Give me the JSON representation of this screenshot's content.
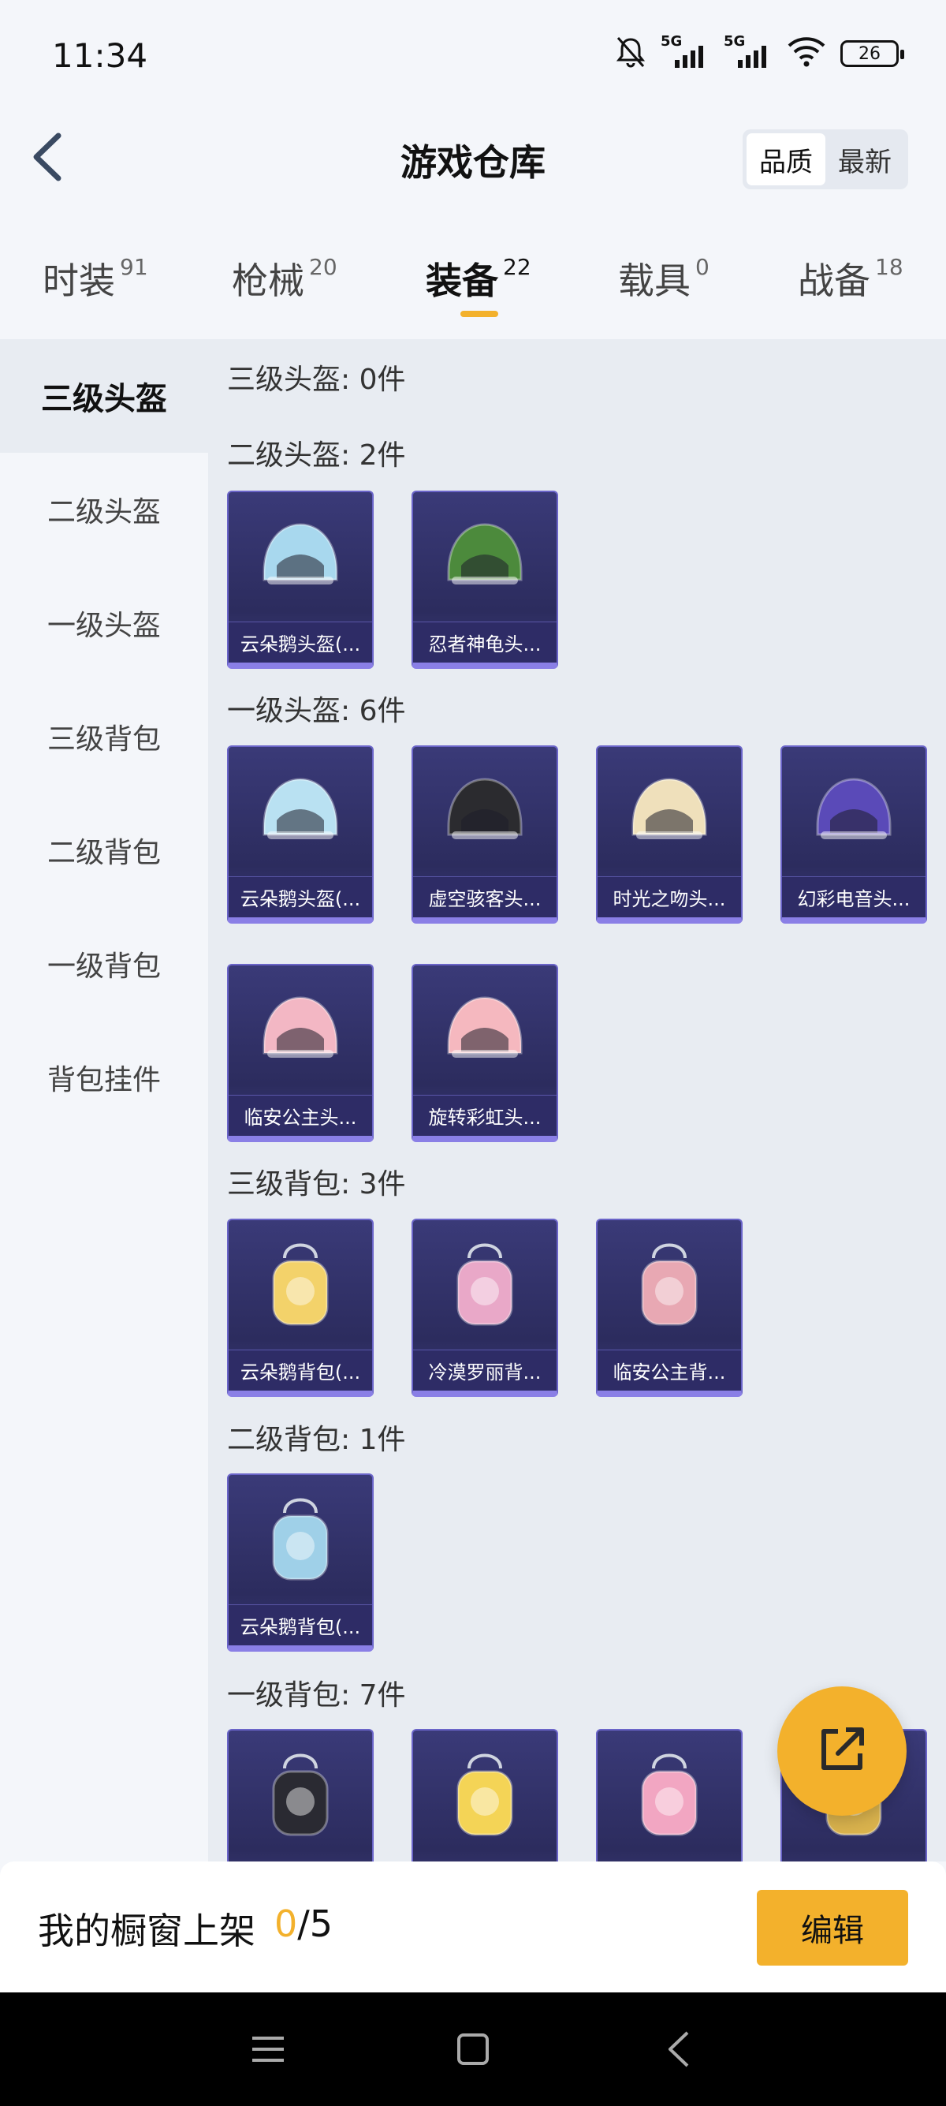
{
  "status_bar": {
    "time": "11:34",
    "signal_1": "5G",
    "signal_2": "5G",
    "battery": "26"
  },
  "header": {
    "title": "游戏仓库",
    "sort_options": [
      "品质",
      "最新"
    ],
    "sort_active": "品质"
  },
  "tabs": [
    {
      "label": "时装",
      "count": "91"
    },
    {
      "label": "枪械",
      "count": "20"
    },
    {
      "label": "装备",
      "count": "22",
      "active": true
    },
    {
      "label": "载具",
      "count": "0"
    },
    {
      "label": "战备",
      "count": "18"
    }
  ],
  "sidebar": {
    "items": [
      {
        "label": "三级头盔",
        "active": true
      },
      {
        "label": "二级头盔"
      },
      {
        "label": "一级头盔"
      },
      {
        "label": "三级背包"
      },
      {
        "label": "二级背包"
      },
      {
        "label": "一级背包"
      },
      {
        "label": "背包挂件"
      }
    ]
  },
  "sections": [
    {
      "title": "三级头盔: 0件",
      "items": []
    },
    {
      "title": "二级头盔: 2件",
      "items": [
        {
          "name": "云朵鹅头盔(...",
          "icon": "helmet-cloud-goose-icon",
          "color": "#a8d8ee"
        },
        {
          "name": "忍者神龟头...",
          "icon": "helmet-ninja-turtle-icon",
          "color": "#4c8a3c"
        }
      ]
    },
    {
      "title": "一级头盔: 6件",
      "items": [
        {
          "name": "云朵鹅头盔(...",
          "icon": "helmet-cloud-goose-icon",
          "color": "#b9e1f2"
        },
        {
          "name": "虚空骇客头...",
          "icon": "helmet-void-hacker-icon",
          "color": "#2b2b2f"
        },
        {
          "name": "时光之吻头...",
          "icon": "helmet-time-kiss-icon",
          "color": "#efe0bb"
        },
        {
          "name": "幻彩电音头...",
          "icon": "helmet-electro-icon",
          "color": "#5a4ab8"
        },
        {
          "name": "临安公主头...",
          "icon": "helmet-linan-princess-icon",
          "color": "#f3b7c4"
        },
        {
          "name": "旋转彩虹头...",
          "icon": "helmet-rainbow-icon",
          "color": "#f5b8bf"
        }
      ]
    },
    {
      "title": "三级背包: 3件",
      "items": [
        {
          "name": "云朵鹅背包(...",
          "icon": "backpack-cloud-goose-icon",
          "color": "#f3d26a"
        },
        {
          "name": "冷漠罗丽背...",
          "icon": "backpack-heart-icon",
          "color": "#e9a8c8"
        },
        {
          "name": "临安公主背...",
          "icon": "backpack-flower-icon",
          "color": "#e8a8b3"
        }
      ]
    },
    {
      "title": "二级背包: 1件",
      "items": [
        {
          "name": "云朵鹅背包(...",
          "icon": "backpack-cloud-goose-icon",
          "color": "#9fd0e8"
        }
      ]
    },
    {
      "title": "一级背包: 7件",
      "items": [
        {
          "name": "",
          "icon": "backpack-dark-icon",
          "color": "#2a2a32"
        },
        {
          "name": "",
          "icon": "backpack-flower-icon",
          "color": "#f4d456"
        },
        {
          "name": "",
          "icon": "backpack-arcade-icon",
          "color": "#f2a6c2"
        },
        {
          "name": "",
          "icon": "backpack-gold-icon",
          "color": "#d9b24d"
        }
      ]
    }
  ],
  "showcase": {
    "label": "我的橱窗上架",
    "used": "0",
    "total": "/5"
  },
  "edit_button": "编辑",
  "colors": {
    "accent": "#f3b12c",
    "card_bg": "#2e2c66",
    "card_border": "#8a7fe6"
  }
}
